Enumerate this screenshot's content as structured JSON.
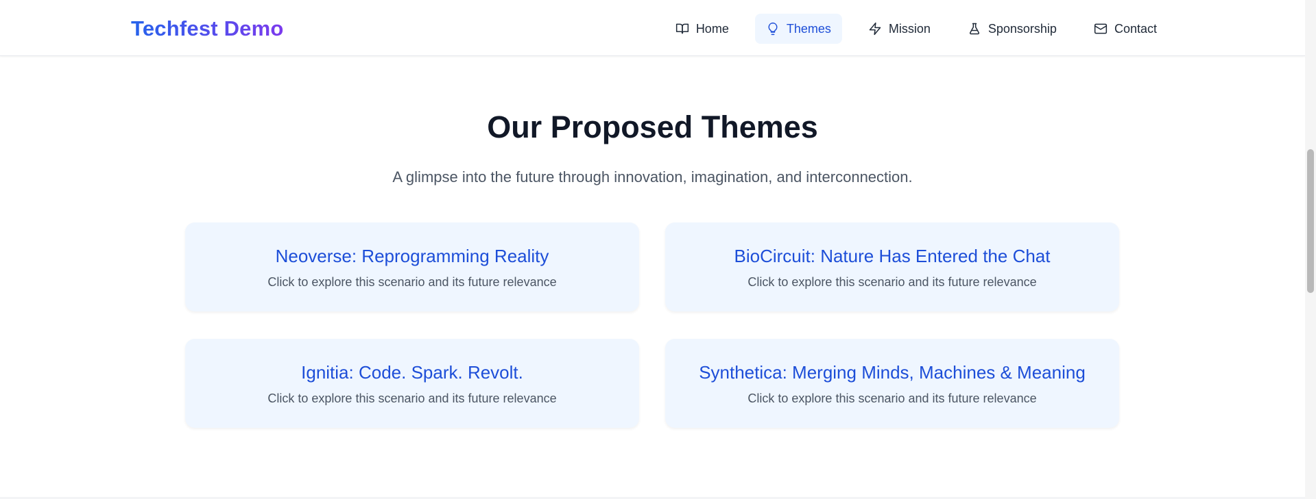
{
  "brand": "Techfest Demo",
  "nav": [
    {
      "label": "Home",
      "icon": "book-open-icon"
    },
    {
      "label": "Themes",
      "icon": "lightbulb-icon"
    },
    {
      "label": "Mission",
      "icon": "lightning-icon"
    },
    {
      "label": "Sponsorship",
      "icon": "flask-icon"
    },
    {
      "label": "Contact",
      "icon": "mail-icon"
    }
  ],
  "active_nav": "Themes",
  "section": {
    "title": "Our Proposed Themes",
    "subtitle": "A glimpse into the future through innovation, imagination, and interconnection."
  },
  "themes": [
    {
      "title": "Neoverse: Reprogramming Reality",
      "description": "Click to explore this scenario and its future relevance"
    },
    {
      "title": "BioCircuit: Nature Has Entered the Chat",
      "description": "Click to explore this scenario and its future relevance"
    },
    {
      "title": "Ignitia: Code. Spark. Revolt.",
      "description": "Click to explore this scenario and its future relevance"
    },
    {
      "title": "Synthetica: Merging Minds, Machines & Meaning",
      "description": "Click to explore this scenario and its future relevance"
    }
  ],
  "colors": {
    "accent": "#1d4ed8",
    "brand_gradient_start": "#2563eb",
    "brand_gradient_end": "#7c3aed",
    "card_background": "#eff6ff",
    "heading": "#111827"
  }
}
